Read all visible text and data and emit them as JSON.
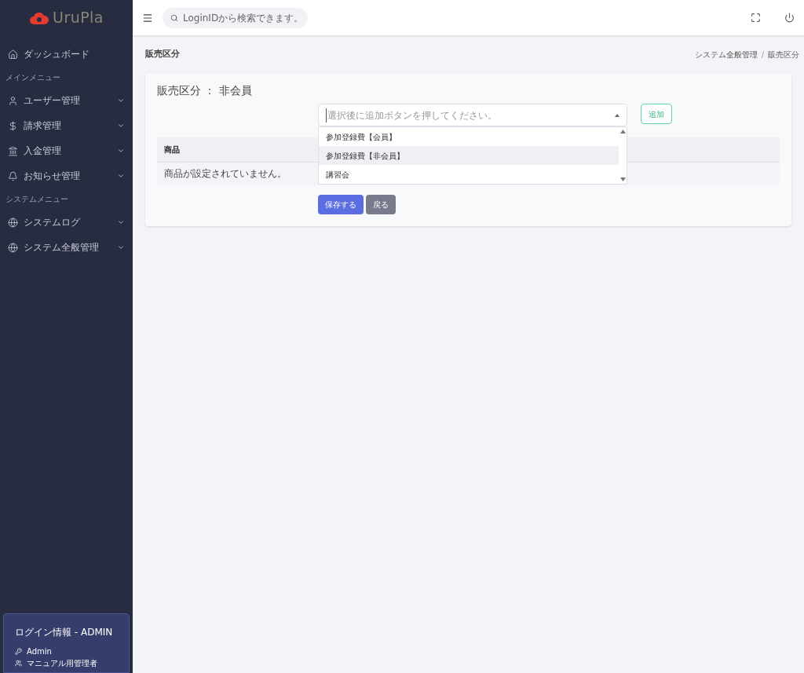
{
  "brand": {
    "name": "UruPla"
  },
  "sidebar": {
    "items": [
      {
        "kind": "link",
        "label": "ダッシュボード",
        "expandable": false
      },
      {
        "kind": "heading",
        "label": "メインメニュー"
      },
      {
        "kind": "link",
        "label": "ユーザー管理",
        "expandable": true
      },
      {
        "kind": "link",
        "label": "請求管理",
        "expandable": true
      },
      {
        "kind": "link",
        "label": "入金管理",
        "expandable": true
      },
      {
        "kind": "link",
        "label": "お知らせ管理",
        "expandable": true
      },
      {
        "kind": "heading",
        "label": "システムメニュー"
      },
      {
        "kind": "link",
        "label": "システムログ",
        "expandable": true
      },
      {
        "kind": "link",
        "label": "システム全般管理",
        "expandable": true
      }
    ],
    "login": {
      "title": "ログイン情報 - ADMIN",
      "user": "Admin",
      "role": "マニュアル用管理者"
    }
  },
  "header": {
    "search": {
      "placeholder": "LoginIDから検索できます。"
    }
  },
  "page": {
    "title": "販売区分",
    "breadcrumb": [
      "システム全般管理",
      "販売区分"
    ],
    "breadcrumb_separator": "/"
  },
  "card": {
    "title": "販売区分 ： 非会員",
    "select": {
      "placeholder": "選択後に追加ボタンを押してください。",
      "expanded": true,
      "options": [
        {
          "label": "参加登録費【会員】",
          "selected": false
        },
        {
          "label": "参加登録費【非会員】",
          "selected": true
        },
        {
          "label": "講習会",
          "selected": false
        }
      ]
    },
    "add_button": "追加",
    "table": {
      "columns": [
        "商品"
      ],
      "empty": "商品が設定されていません。"
    },
    "save_button": "保存する",
    "back_button": "戻る"
  }
}
